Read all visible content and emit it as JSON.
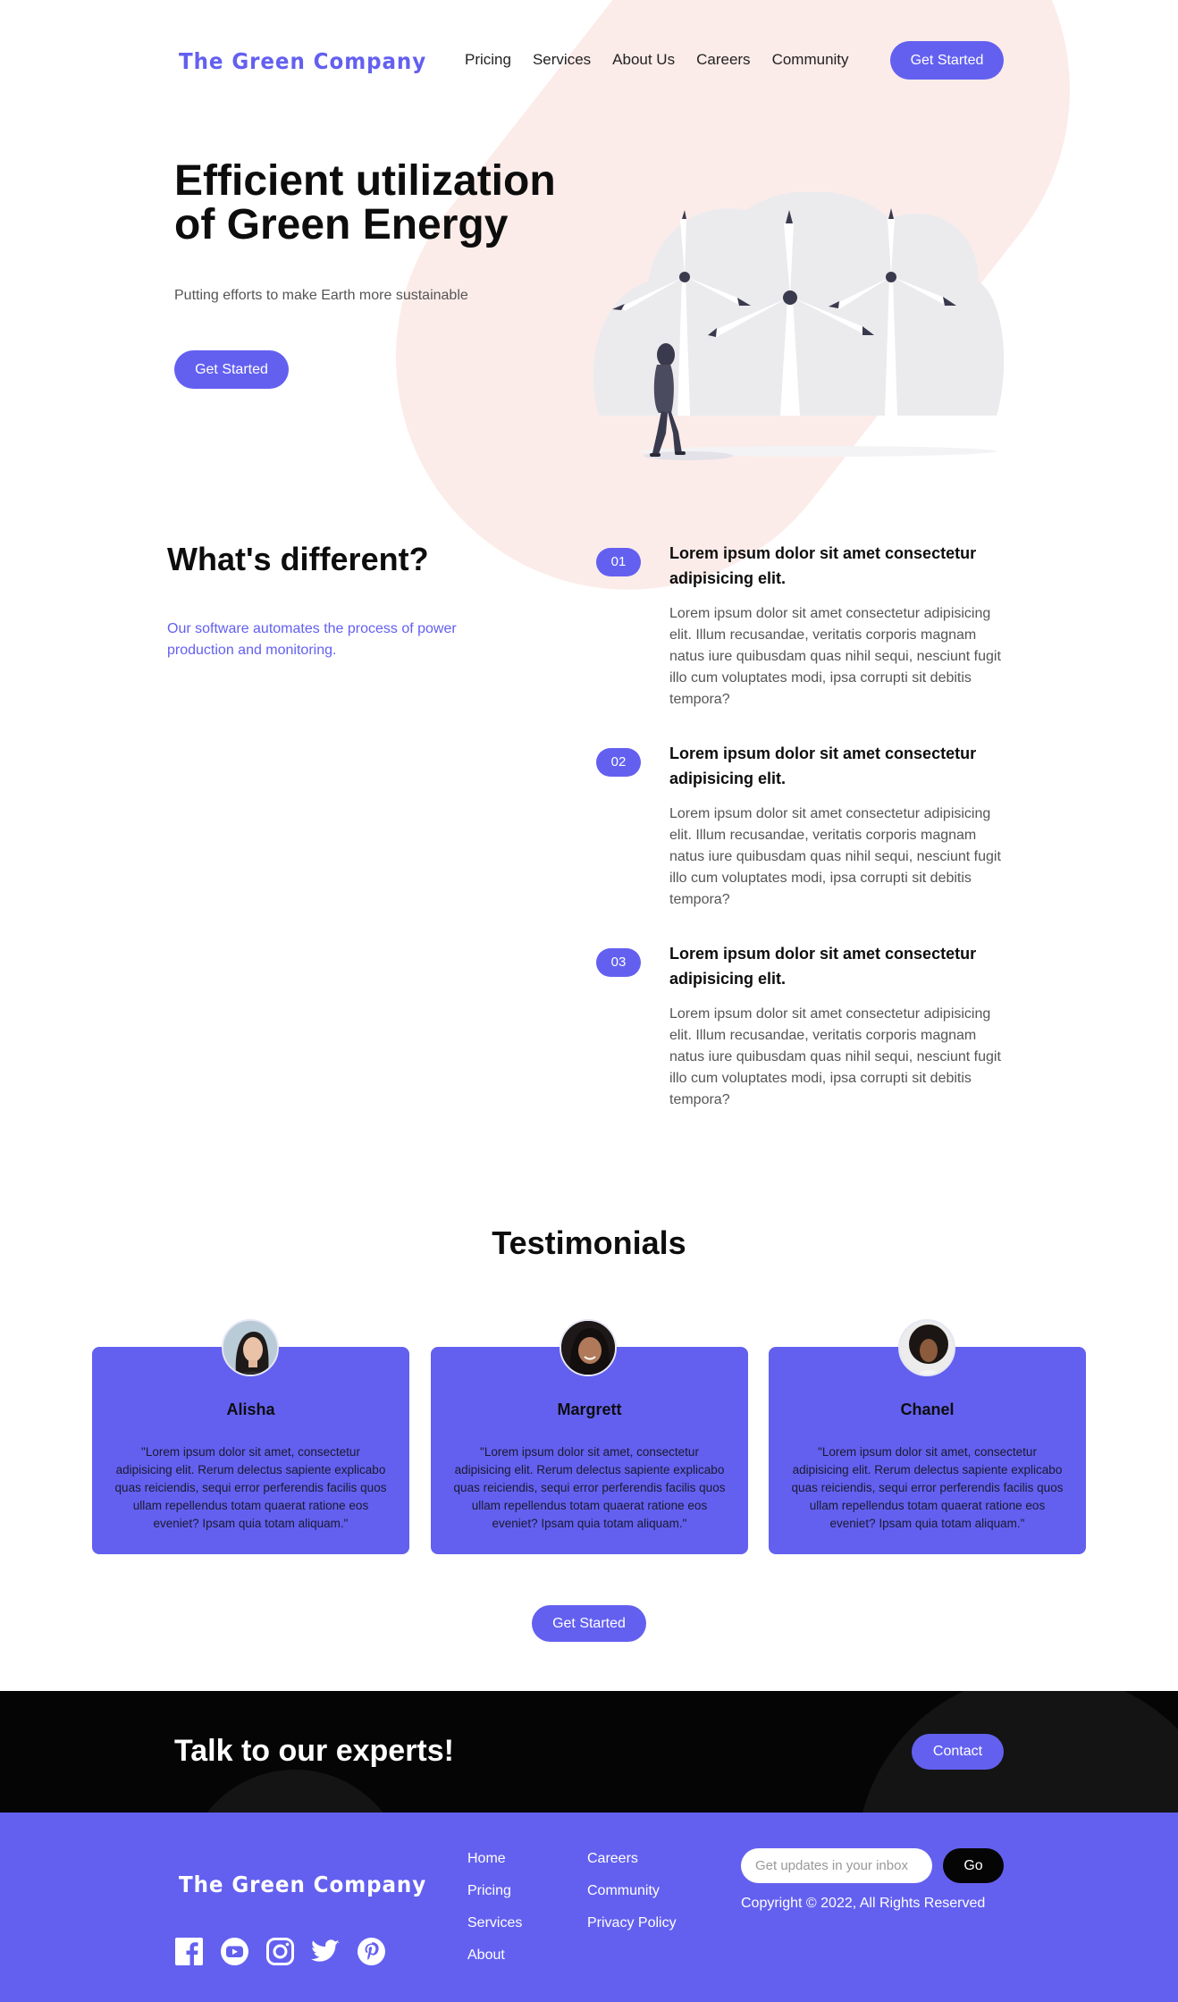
{
  "header": {
    "logo": "The Green Company",
    "nav": [
      "Pricing",
      "Services",
      "About Us",
      "Careers",
      "Community"
    ],
    "cta": "Get Started"
  },
  "hero": {
    "title_line1": "Efficient utilization",
    "title_line2": "of Green Energy",
    "subtitle": "Putting efforts to make Earth more sustainable",
    "cta": "Get Started",
    "illustration_icon": "wind-turbines-illustration"
  },
  "different": {
    "title": "What's different?",
    "subtitle": "Our software automates the process of power production and monitoring.",
    "features": [
      {
        "num": "01",
        "title": "Lorem ipsum dolor sit amet consectetur adipisicing elit.",
        "body": "Lorem ipsum dolor sit amet consectetur adipisicing elit. Illum recusandae, veritatis corporis magnam natus iure quibusdam quas nihil sequi, nesciunt fugit illo cum voluptates modi, ipsa corrupti sit debitis tempora?"
      },
      {
        "num": "02",
        "title": "Lorem ipsum dolor sit amet consectetur adipisicing elit.",
        "body": "Lorem ipsum dolor sit amet consectetur adipisicing elit. Illum recusandae, veritatis corporis magnam natus iure quibusdam quas nihil sequi, nesciunt fugit illo cum voluptates modi, ipsa corrupti sit debitis tempora?"
      },
      {
        "num": "03",
        "title": "Lorem ipsum dolor sit amet consectetur adipisicing elit.",
        "body": "Lorem ipsum dolor sit amet consectetur adipisicing elit. Illum recusandae, veritatis corporis magnam natus iure quibusdam quas nihil sequi, nesciunt fugit illo cum voluptates modi, ipsa corrupti sit debitis tempora?"
      }
    ]
  },
  "testimonials": {
    "title": "Testimonials",
    "items": [
      {
        "name": "Alisha",
        "quote": "\"Lorem ipsum dolor sit amet, consectetur adipisicing elit. Rerum delectus sapiente explicabo quas reiciendis, sequi error perferendis facilis quos ullam repellendus totam quaerat ratione eos eveniet? Ipsam quia totam aliquam.\""
      },
      {
        "name": "Margrett",
        "quote": "\"Lorem ipsum dolor sit amet, consectetur adipisicing elit. Rerum delectus sapiente explicabo quas reiciendis, sequi error perferendis facilis quos ullam repellendus totam quaerat ratione eos eveniet? Ipsam quia totam aliquam.\""
      },
      {
        "name": "Chanel",
        "quote": "\"Lorem ipsum dolor sit amet, consectetur adipisicing elit. Rerum delectus sapiente explicabo quas reiciendis, sequi error perferendis facilis quos ullam repellendus totam quaerat ratione eos eveniet? Ipsam quia totam aliquam.\""
      }
    ],
    "cta": "Get Started"
  },
  "experts": {
    "title": "Talk to our experts!",
    "cta": "Contact"
  },
  "footer": {
    "logo": "The Green Company",
    "socials": [
      "facebook-icon",
      "youtube-icon",
      "instagram-icon",
      "twitter-icon",
      "pinterest-icon"
    ],
    "col1": [
      "Home",
      "Pricing",
      "Services",
      "About"
    ],
    "col2": [
      "Careers",
      "Community",
      "Privacy Policy"
    ],
    "subscribe_placeholder": "Get updates in your inbox",
    "go": "Go",
    "copyright": "Copyright © 2022, All Rights Reserved"
  },
  "colors": {
    "accent": "#6360f0",
    "dark": "#050505",
    "pink": "#fcece9"
  }
}
